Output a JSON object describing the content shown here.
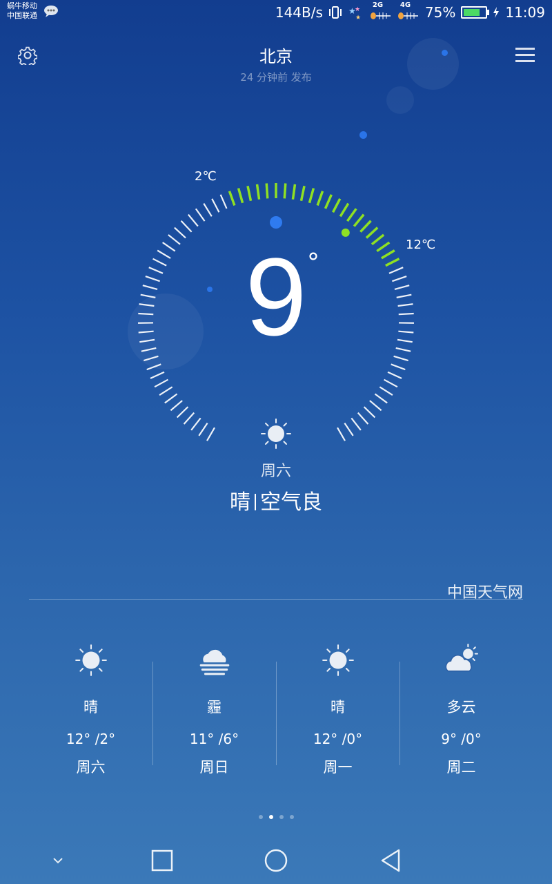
{
  "status_bar": {
    "carrier_1": "蜗牛移动",
    "carrier_2": "中国联通",
    "net_speed": "144B/s",
    "signal_1_label": "2G",
    "signal_2_label": "4G",
    "battery_percent": "75%",
    "battery_level": 0.75,
    "time": "11:09"
  },
  "header": {
    "settings_icon": "gear-icon",
    "city": "北京",
    "published": "24 分钟前 发布",
    "menu_icon": "hamburger-menu-icon"
  },
  "current": {
    "temperature": "9",
    "degree_symbol": "°",
    "low_label": "2℃",
    "high_label": "12℃",
    "low": 2,
    "high": 12,
    "day": "周六",
    "condition": "晴",
    "air_quality": "空气良",
    "icon": "sun-icon"
  },
  "source": "中国天气网",
  "forecast": [
    {
      "icon": "sun-icon",
      "condition": "晴",
      "temps": "12°  /2°",
      "day": "周六"
    },
    {
      "icon": "haze-icon",
      "condition": "霾",
      "temps": "11°  /6°",
      "day": "周日"
    },
    {
      "icon": "sun-icon",
      "condition": "晴",
      "temps": "12°  /0°",
      "day": "周一"
    },
    {
      "icon": "partly-cloudy-icon",
      "condition": "多云",
      "temps": "9°  /0°",
      "day": "周二"
    }
  ],
  "pager": {
    "pages": 4,
    "active": 1
  },
  "nav": {
    "hide_icon": "chevron-down-icon",
    "recents_icon": "square-icon",
    "home_icon": "circle-icon",
    "back_icon": "triangle-back-icon"
  },
  "colors": {
    "accent_green": "#8fe023",
    "background_top": "#123d8f",
    "background_bottom": "#3b79b8"
  }
}
